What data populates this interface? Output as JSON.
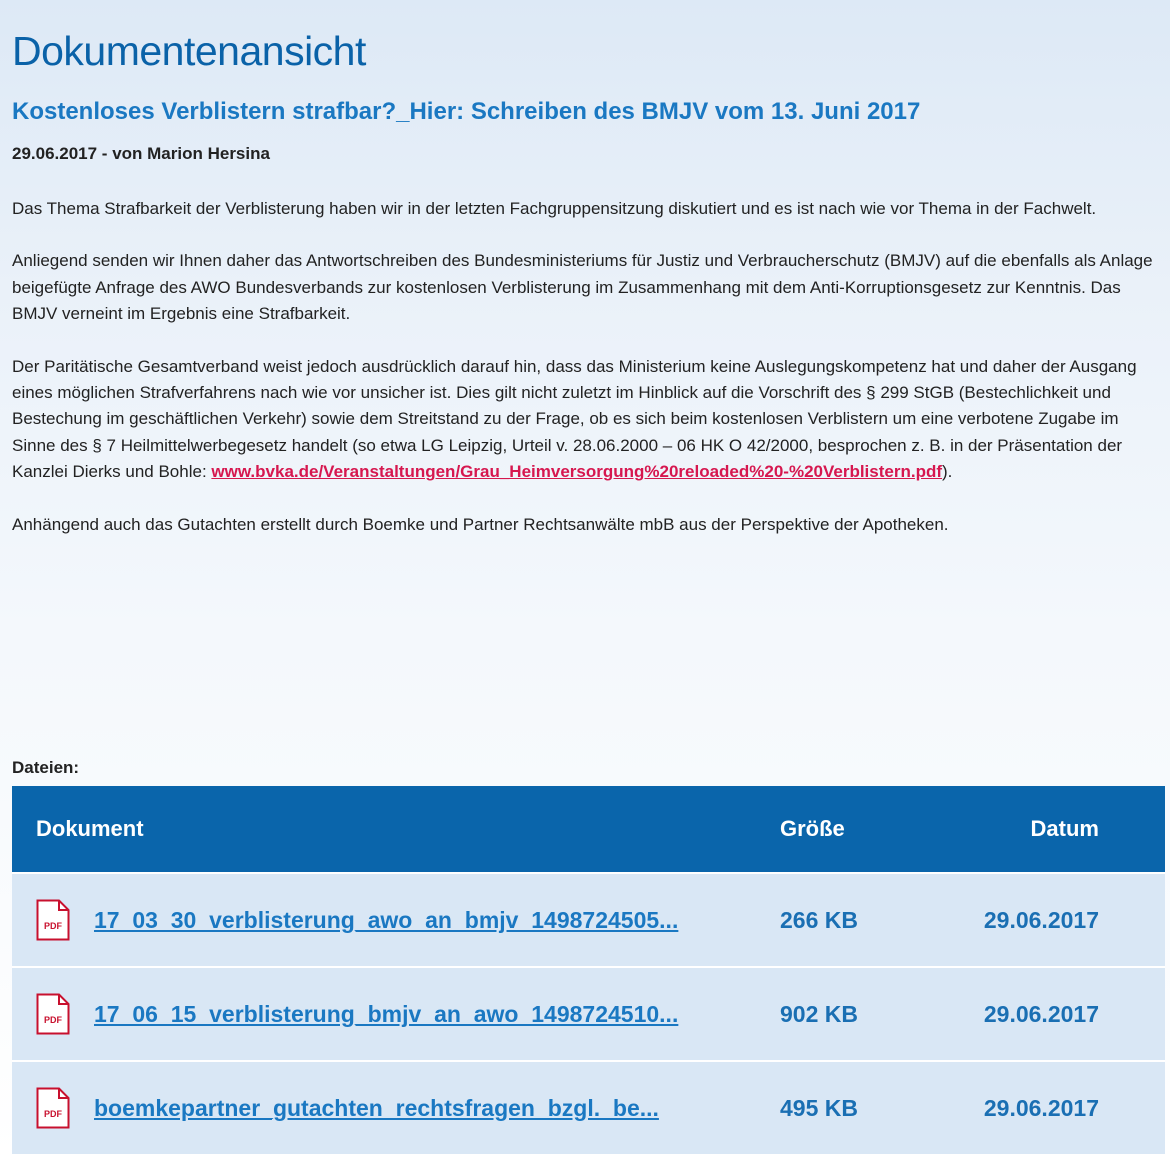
{
  "page_title": "Dokumentenansicht",
  "document": {
    "title": "Kostenloses Verblistern strafbar?_Hier: Schreiben des BMJV vom 13. Juni 2017",
    "meta": "29.06.2017 - von Marion Hersina",
    "paragraphs": [
      "Das Thema Strafbarkeit der Verblisterung haben wir in der letzten Fachgruppensitzung diskutiert und es ist nach wie vor Thema in der Fachwelt.",
      "Anliegend senden wir Ihnen daher das Antwortschreiben des Bundesministeriums für Justiz und Verbraucherschutz (BMJV) auf die ebenfalls als Anlage beigefügte Anfrage des AWO Bundesverbands zur kostenlosen Verblisterung im Zusammenhang mit dem Anti-Korruptionsgesetz zur Kenntnis. Das BMJV verneint im Ergebnis eine Strafbarkeit.",
      "Anhängend auch das Gutachten erstellt durch Boemke und Partner Rechtsanwälte mbB aus der Perspektive der Apotheken."
    ],
    "paragraph3_before_link": "Der Paritätische Gesamtverband weist jedoch ausdrücklich darauf hin, dass das Ministerium keine Auslegungskompetenz hat und daher der Ausgang eines möglichen Strafverfahrens nach wie vor unsicher ist. Dies gilt nicht zuletzt im Hinblick auf die Vorschrift des § 299 StGB (Bestechlichkeit und Bestechung im geschäftlichen Verkehr) sowie dem Streitstand zu der Frage, ob es sich beim kostenlosen Verblistern um eine verbotene Zugabe im Sinne des § 7 Heilmittelwerbegesetz handelt (so etwa LG Leipzig, Urteil v. 28.06.2000 – 06 HK O 42/2000, besprochen z. B. in der Präsentation der Kanzlei Dierks und Bohle: ",
    "paragraph3_link": "www.bvka.de/Veranstaltungen/Grau_Heimversorgung%20reloaded%20-%20Verblistern.pdf",
    "paragraph3_after_link": ")."
  },
  "files": {
    "label": "Dateien:",
    "headers": {
      "document": "Dokument",
      "size": "Größe",
      "date": "Datum"
    },
    "rows": [
      {
        "name": "17_03_30_verblisterung_awo_an_bmjv_1498724505...",
        "size": "266 KB",
        "date": "29.06.2017",
        "icon": "pdf-icon",
        "icon_label": "PDF"
      },
      {
        "name": "17_06_15_verblisterung_bmjv_an_awo_1498724510...",
        "size": "902 KB",
        "date": "29.06.2017",
        "icon": "pdf-icon",
        "icon_label": "PDF"
      },
      {
        "name": "boemkepartner_gutachten_rechtsfragen_bzgl._be...",
        "size": "495 KB",
        "date": "29.06.2017",
        "icon": "pdf-icon",
        "icon_label": "PDF"
      }
    ]
  },
  "colors": {
    "title_blue": "#0a62a8",
    "link_red": "#d6174f",
    "header_blue": "#0a65ab",
    "row_bg": "#d9e7f5"
  }
}
